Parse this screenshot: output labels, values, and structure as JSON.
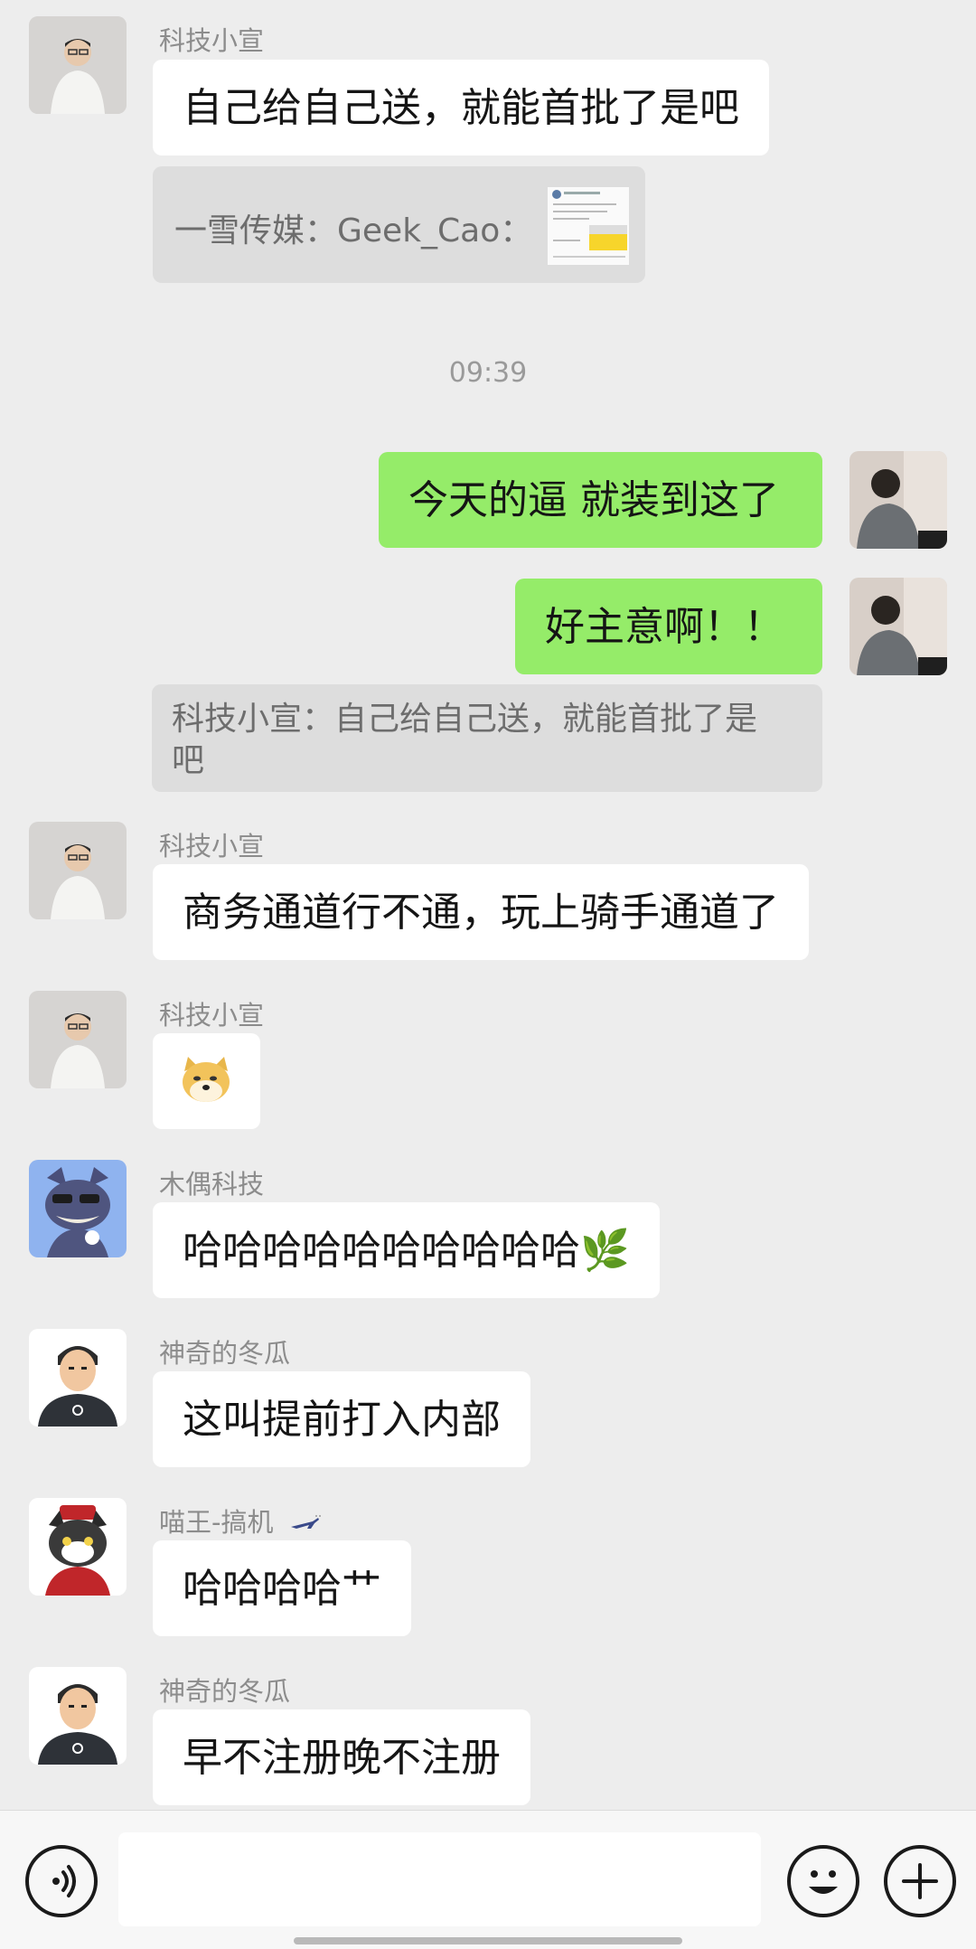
{
  "messages": [
    {
      "sender": "科技小宣",
      "text": "自己给自己送，就能首批了是吧",
      "quote": "一雪传媒：Geek_Cao："
    },
    {
      "time": "09:39"
    },
    {
      "self": true,
      "text": "今天的逼 就装到这了"
    },
    {
      "self": true,
      "text": "好主意啊！！",
      "quote": "科技小宣：自己给自己送，就能首批了是吧"
    },
    {
      "sender": "科技小宣",
      "text": "商务通道行不通，玩上骑手通道了"
    },
    {
      "sender": "科技小宣",
      "sticker": "doge-emoji"
    },
    {
      "sender": "木偶科技",
      "text": "哈哈哈哈哈哈哈哈哈哈",
      "emoji": "🌿"
    },
    {
      "sender": "神奇的冬瓜",
      "text": "这叫提前打入内部"
    },
    {
      "sender": "喵王-搞机",
      "text": "哈哈哈哈艹"
    },
    {
      "sender": "神奇的冬瓜",
      "text": "早不注册晚不注册"
    }
  ],
  "quote2_line1": "科技小宣：自己给自己送，就能首批了是",
  "quote2_line2": "吧",
  "icons": {
    "voice": "voice-icon",
    "emoji": "emoji-icon",
    "plus": "plus-icon"
  }
}
